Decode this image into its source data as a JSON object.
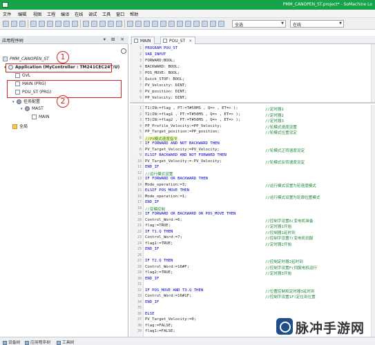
{
  "window": {
    "title": "PMM_CANOPEN_ST.project* - SoMachine Lo"
  },
  "menu": [
    "文件",
    "编辑",
    "视图",
    "工程",
    "编译",
    "在线",
    "调试",
    "工具",
    "窗口",
    "帮助"
  ],
  "toolbar": {
    "config_combo": "全选",
    "online_combo": "在线"
  },
  "left_pane": {
    "title": "应用程序树",
    "tree": {
      "project": "PMM_CANOPEN_ST",
      "application": "Application (MyController : TM241CEC24T/U)",
      "gvl": "GVL",
      "main": "MAIN (PRG)",
      "pou": "POU_ST (PRG)",
      "task_config": "任务配置",
      "mast": "MAST",
      "mast_main": "MAIN",
      "global": "全局"
    },
    "annotations": [
      "1",
      "2"
    ]
  },
  "editor": {
    "tabs": [
      {
        "label": "MAIN",
        "active": false
      },
      {
        "label": "POU_ST",
        "active": true
      }
    ],
    "declaration": [
      {
        "n": "1",
        "text": "PROGRAM POU_ST"
      },
      {
        "n": "2",
        "text": "VAR_INPUT"
      },
      {
        "n": "3",
        "text": "    FORWARD:BOOL;"
      },
      {
        "n": "4",
        "text": "    BACKWARD: BOOL;"
      },
      {
        "n": "5",
        "text": "    POS_MOVE: BOOL;"
      },
      {
        "n": "6",
        "text": "    Quick_STOP: BOOL;"
      },
      {
        "n": "7",
        "text": "    PV_Velocity: DINT;"
      },
      {
        "n": "8",
        "text": "    PV_position: DINT;"
      },
      {
        "n": "9",
        "text": "    PP_Velocity: DINT;"
      }
    ],
    "implementation": [
      {
        "n": "1",
        "code": "T1(IN:=flag , PT:=T#50MS , Q=> , ET=> );",
        "comment": "//定时器1"
      },
      {
        "n": "2",
        "code": "T2(IN:=flag1 , PT:=T#50MS , Q=> , ET=> );",
        "comment": "//定时器2"
      },
      {
        "n": "3",
        "code": "T3(IN:=flag2 , PT:=T#50MS , Q=> , ET=> );",
        "comment": "//定时器3"
      },
      {
        "n": "4",
        "code": "PP_Profile_Velocity:=PP_Velocity;",
        "comment": "//轮模式速度设置"
      },
      {
        "n": "5",
        "code": "PP_Target_position:=PP_position;",
        "comment": "//轮模式位置设定"
      },
      {
        "n": "6",
        "code": "//PV模式速度指令",
        "comment": ""
      },
      {
        "n": "7",
        "code": "IF FORWARD AND NOT BACKWARD THEN",
        "comment": ""
      },
      {
        "n": "8",
        "code": "    PV_Target_Velocity:=PV_Velocity;",
        "comment": "//轮模式正转速度设定"
      },
      {
        "n": "9",
        "code": "ELSIF BACKWARD AND NOT FORWARD THEN",
        "comment": ""
      },
      {
        "n": "10",
        "code": "    PV_Target_Velocity:=-PV_Velocity;",
        "comment": "//轮模式反转速度设定"
      },
      {
        "n": "11",
        "code": "END_IF",
        "comment": ""
      },
      {
        "n": "12",
        "code": "//运行模式设置",
        "comment": ""
      },
      {
        "n": "13",
        "code": "IF FORWARD OR BACKWARD THEN",
        "comment": ""
      },
      {
        "n": "14",
        "code": "    Mode_operation:=3;",
        "comment": "//运行模式设置为轮速度模式"
      },
      {
        "n": "15",
        "code": "ELSIF POS_MOVE THEN",
        "comment": ""
      },
      {
        "n": "16",
        "code": "    Mode_operation:=1;",
        "comment": "//运行模式设置为轮廓位置模式"
      },
      {
        "n": "17",
        "code": "END_IF",
        "comment": ""
      },
      {
        "n": "18",
        "code": "//变模控制",
        "comment": ""
      },
      {
        "n": "19",
        "code": "IF FORWARD OR BACKWARD OR POS_MOVE  THEN",
        "comment": ""
      },
      {
        "n": "20",
        "code": "    Control_Word:=6;",
        "comment": "//控制字设置6(变电机准备"
      },
      {
        "n": "21",
        "code": "    flag:=TRUE;",
        "comment": "//定时器1开始"
      },
      {
        "n": "22",
        "code": "  IF T1.Q THEN",
        "comment": "//控制器1延时到"
      },
      {
        "n": "23",
        "code": "    Control_Word:=7;",
        "comment": "//控制字设置7(变电机伺服"
      },
      {
        "n": "24",
        "code": "    flag1:=TRUE;",
        "comment": "//定时器2开始"
      },
      {
        "n": "25",
        "code": "  END_IF",
        "comment": ""
      },
      {
        "n": "26",
        "code": "",
        "comment": ""
      },
      {
        "n": "27",
        "code": "  IF T2.Q THEN",
        "comment": "//控制定时器2延时到"
      },
      {
        "n": "28",
        "code": "    Control_Word:=16#F;",
        "comment": "//控制字设置F(伺服电机运行"
      },
      {
        "n": "29",
        "code": "    flag2:=TRUE;",
        "comment": "//定时器3开始"
      },
      {
        "n": "30",
        "code": "  END_IF",
        "comment": ""
      },
      {
        "n": "31",
        "code": "",
        "comment": ""
      },
      {
        "n": "32",
        "code": "  IF POS_MOVE AND T3.Q THEN",
        "comment": "//位置控制和定时器3延时到"
      },
      {
        "n": "33",
        "code": "    Control_Word:=16#1F;",
        "comment": "//控制字设置1F(定位到位置"
      },
      {
        "n": "34",
        "code": "  END_IF",
        "comment": ""
      },
      {
        "n": "35",
        "code": "",
        "comment": ""
      },
      {
        "n": "36",
        "code": "ELSE",
        "comment": ""
      },
      {
        "n": "37",
        "code": "    PV_Target_Velocity:=0;",
        "comment": ""
      },
      {
        "n": "38",
        "code": "    flag:=FALSE;",
        "comment": ""
      },
      {
        "n": "39",
        "code": "    flag1:=FALSE;",
        "comment": ""
      }
    ]
  },
  "bottom_tabs": [
    "设备树",
    "应用程序树",
    "工具树"
  ],
  "watermark": "脉冲手游网",
  "colors": {
    "titlebar": "#16a34a",
    "keyword": "#0000c8",
    "comment": "#1e8a3a",
    "annotation": "#d42020",
    "highlight": "#fff7b0"
  }
}
